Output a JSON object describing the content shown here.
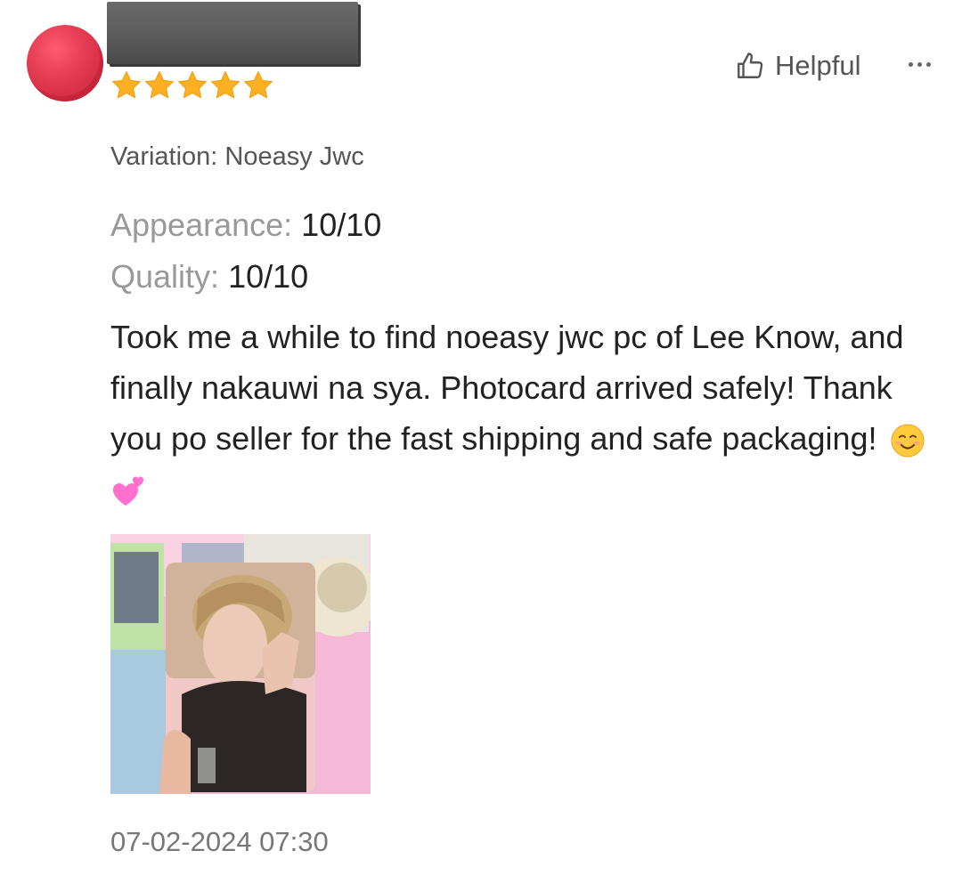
{
  "review": {
    "rating": 5,
    "rating_max": 5,
    "helpful_label": "Helpful",
    "variation": "Variation: Noeasy Jwc",
    "appearance_label": "Appearance:",
    "appearance_value": "10/10",
    "quality_label": "Quality:",
    "quality_value": "10/10",
    "text": "Took me a while to find noeasy jwc pc of Lee Know, and finally nakauwi na sya. Photocard arrived safely! Thank you po seller for the fast shipping and safe packaging!",
    "emojis": [
      "smiling-face-icon",
      "two-hearts-icon"
    ],
    "timestamp": "07-02-2024 07:30"
  },
  "icons": {
    "helpful": "thumbs-up-outline-icon",
    "more": "more-horizontal-icon",
    "star": "star-filled-icon"
  },
  "colors": {
    "star": "#FDB122",
    "avatar": "#E23A50",
    "label_gray": "#999999",
    "text": "#222222"
  }
}
